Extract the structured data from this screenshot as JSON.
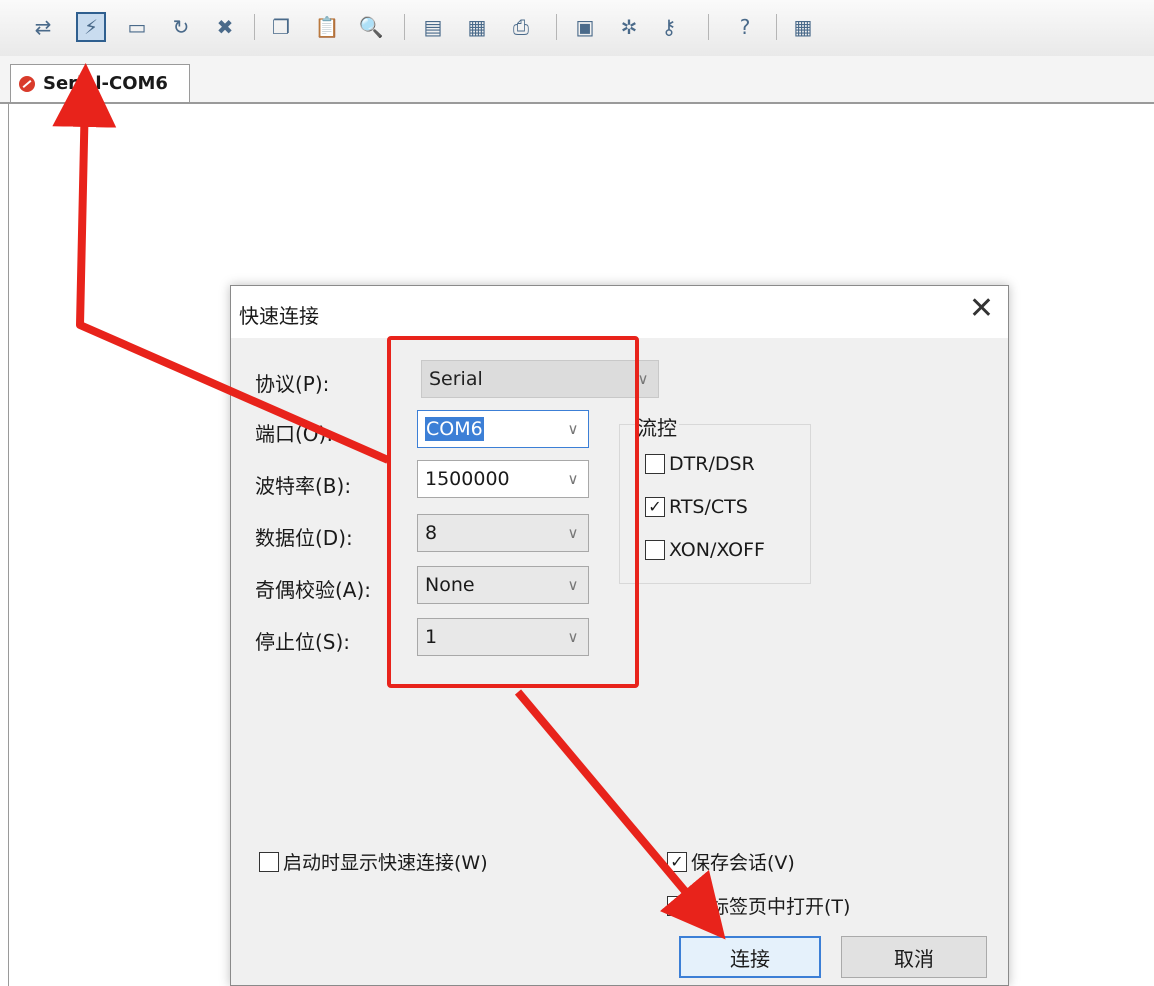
{
  "toolbar": {
    "buttons": [
      {
        "icon": "connect-icon"
      },
      {
        "icon": "quick-connect-icon"
      },
      {
        "icon": "connect-in-tab-icon"
      },
      {
        "icon": "reconnect-icon"
      },
      {
        "icon": "disconnect-icon"
      },
      {
        "icon": "copy-icon"
      },
      {
        "icon": "paste-icon"
      },
      {
        "icon": "find-icon"
      },
      {
        "icon": "print-setup-icon"
      },
      {
        "icon": "print-screen-icon"
      },
      {
        "icon": "print-icon"
      },
      {
        "icon": "session-options-icon"
      },
      {
        "icon": "global-options-icon"
      },
      {
        "icon": "keymap-icon"
      },
      {
        "icon": "help-icon"
      },
      {
        "icon": "about-icon"
      }
    ]
  },
  "tab": {
    "label": "Serial-COM6"
  },
  "dialog": {
    "title": "快速连接",
    "close_glyph": "✕",
    "fields": {
      "protocol": {
        "label": "协议(P):",
        "value": "Serial"
      },
      "port": {
        "label": "端口(O):",
        "value": "COM6"
      },
      "baud": {
        "label": "波特率(B):",
        "value": "1500000"
      },
      "databits": {
        "label": "数据位(D):",
        "value": "8"
      },
      "parity": {
        "label": "奇偶校验(A):",
        "value": "None"
      },
      "stopbits": {
        "label": "停止位(S):",
        "value": "1"
      }
    },
    "flow_control": {
      "label": "流控",
      "options": [
        {
          "label": "DTR/DSR",
          "checked": false
        },
        {
          "label": "RTS/CTS",
          "checked": true
        },
        {
          "label": "XON/XOFF",
          "checked": false
        }
      ]
    },
    "show_on_startup": {
      "label": "启动时显示快速连接(W)",
      "checked": false
    },
    "save_session": {
      "label": "保存会话(V)",
      "checked": true
    },
    "open_in_tab": {
      "label": "在标签页中打开(T)",
      "checked": false
    },
    "connect_label": "连接",
    "cancel_label": "取消"
  },
  "colors": {
    "annotation": "#e8231b",
    "accent": "#3c7fd6"
  }
}
